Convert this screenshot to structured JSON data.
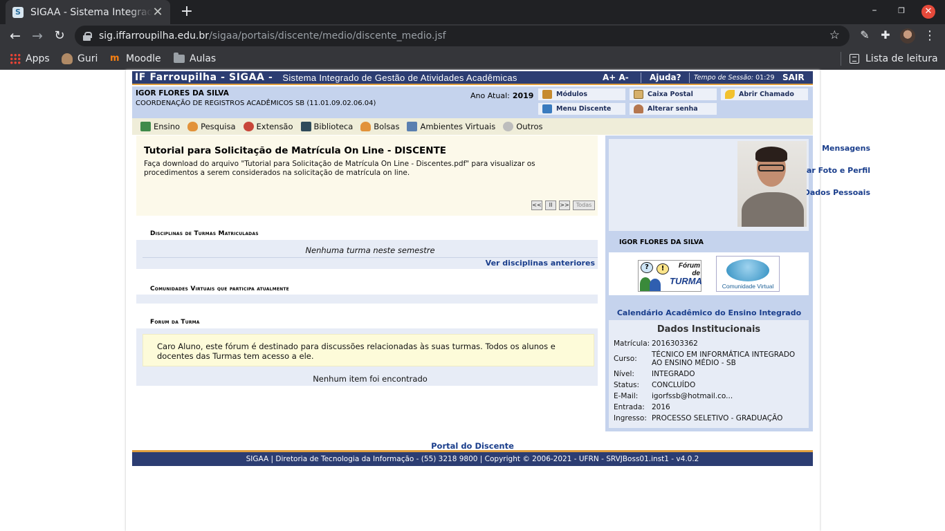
{
  "browser": {
    "tab_title": "SIGAA - Sistema Integrado de Gestão de Atividades Acadêmicas",
    "new_tab": "+",
    "url_host": "sig.iffarroupilha.edu.br",
    "url_path": "/sigaa/portais/discente/medio/discente_medio.jsf",
    "bookmarks": [
      "Apps",
      "Guri",
      "Moodle",
      "Aulas"
    ],
    "reading_list": "Lista de leitura"
  },
  "header": {
    "brand": "IF Farroupilha - SIGAA -",
    "subtitle": "Sistema Integrado de Gestão de Atividades Acadêmicas",
    "font_controls": "A+ A-",
    "help": "Ajuda?",
    "session_label": "Tempo de Sessão:",
    "session_time": "01:29",
    "exit": "SAIR"
  },
  "user": {
    "name": "IGOR FLORES DA SILVA",
    "unit": "COORDENAÇÃO DE REGISTROS ACADÊMICOS SB (11.01.09.02.06.04)",
    "year_label": "Ano Atual:",
    "year": "2019"
  },
  "quick_buttons": {
    "modulos": "Módulos",
    "caixa_postal": "Caixa Postal",
    "abrir_chamado": "Abrir Chamado",
    "menu_discente": "Menu Discente",
    "alterar_senha": "Alterar senha"
  },
  "menu": [
    "Ensino",
    "Pesquisa",
    "Extensão",
    "Biblioteca",
    "Bolsas",
    "Ambientes Virtuais",
    "Outros"
  ],
  "notice": {
    "title": "Tutorial para Solicitação de Matrícula On Line - DISCENTE",
    "text": "Faça download do arquivo \"Tutorial para Solicitação de Matrícula On Line - Discentes.pdf\" para visualizar os procedimentos a serem considerados  na solicitação de matrícula on line.",
    "pager": [
      "<<",
      "II",
      ">>",
      "Todas"
    ]
  },
  "sections": {
    "disciplinas_title": "Disciplinas de Turmas Matriculadas",
    "disciplinas_empty": "Nenhuma turma neste semestre",
    "disciplinas_link": "Ver disciplinas anteriores",
    "comunidades_title": "Comunidades Virtuais que participa atualmente",
    "forum_title": "Forum da Turma",
    "forum_text": "Caro Aluno, este fórum é destinado para discussões relacionadas às suas turmas. Todos os alunos e docentes das Turmas tem acesso a ele.",
    "forum_empty": "Nenhum item foi encontrado"
  },
  "sidebar": {
    "links": [
      "Mensagens",
      "Atualizar Foto e Perfil",
      "Meus Dados Pessoais"
    ],
    "name": "IGOR FLORES DA SILVA",
    "forum_banner": [
      "Fórum",
      "de",
      "TURMA"
    ],
    "cv_banner": "Comunidade Virtual",
    "calendar_link": "Calendário Acadêmico do Ensino Integrado",
    "inst_title": "Dados Institucionais",
    "inst": [
      {
        "label": "Matrícula:",
        "value": "2016303362"
      },
      {
        "label": "Curso:",
        "value": "TÉCNICO EM INFORMÁTICA INTEGRADO AO ENSINO MÉDIO - SB"
      },
      {
        "label": "Nível:",
        "value": "INTEGRADO"
      },
      {
        "label": "Status:",
        "value": "CONCLUÍDO"
      },
      {
        "label": "E-Mail:",
        "value": "igorfssb@hotmail.co..."
      },
      {
        "label": "Entrada:",
        "value": "2016"
      },
      {
        "label": "Ingresso:",
        "value": "PROCESSO SELETIVO - GRADUAÇÃO"
      }
    ]
  },
  "footer": {
    "portal_link": "Portal do Discente",
    "copyright": "SIGAA | Diretoria de Tecnologia da Informação - (55) 3218 9800 | Copyright © 2006-2021 - UFRN - SRVJBoss01.inst1 - v4.0.2"
  },
  "colors": {
    "header": "#2c3d72",
    "accent": "#e09f3e",
    "panel": "#c5d3ed",
    "link": "#1a3e8c"
  }
}
